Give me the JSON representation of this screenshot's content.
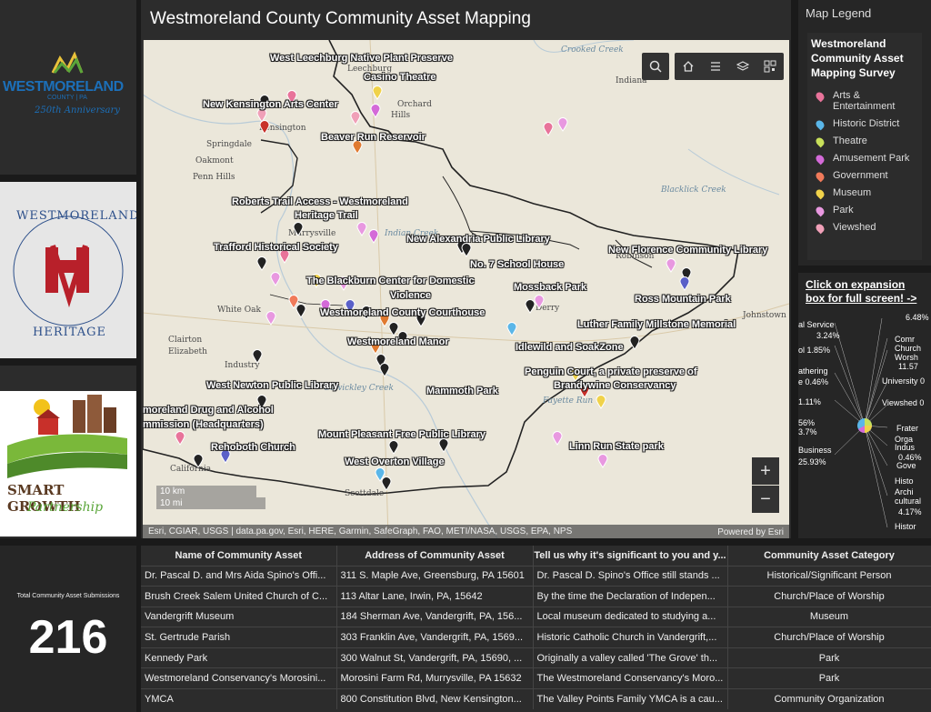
{
  "logos": {
    "westmoreland_line1": "WESTMORELAND",
    "westmoreland_line2": "COUNTY | PA",
    "westmoreland_line3": "250th Anniversary",
    "heritage_top": "WESTMORELAND",
    "heritage_bottom": "HERITAGE",
    "smart_growth_line1": "SMART GROWTH",
    "smart_growth_line2": "Partnership"
  },
  "map": {
    "title": "Westmoreland County Community Asset Mapping",
    "places": [
      "West Leechburg Native Plant Preserve",
      "Casino Theatre",
      "New Kensington Arts Center",
      "Beaver Run Reservoir",
      "Roberts Trail Access - Westmoreland",
      "Heritage Trail",
      "Trafford Historical Society",
      "New Alexandria Public Library",
      "New Florence Community Library",
      "No. 7 School House",
      "The Blackburn Center for Domestic",
      "Violence",
      "Mossback Park",
      "Ross Mountain Park",
      "Westmoreland County Courthouse",
      "Luther Family Millstone Memorial",
      "Westmoreland Manor",
      "Idlewild and SoakZone",
      "Penguin Court, a private preserve of",
      "Brandywine Conservancy",
      "West Newton Public Library",
      "Mammoth Park",
      "moreland Drug and Alcohol",
      "mmission (Headquarters)",
      "Mount Pleasant Free Public Library",
      "Rehoboth Church",
      "Linn Run State park",
      "West Overton Village"
    ],
    "towns": [
      "Leechburg",
      "Orchard",
      "Hills",
      "Indiana",
      "Kensington",
      "Springdale",
      "Oakmont",
      "Penn Hills",
      "Murrysville",
      "White Oak",
      "Clairton",
      "Elizabeth",
      "Industry",
      "California",
      "Scottdale",
      "Johnstown",
      "Robinson",
      "Derry",
      "Crooked Creek",
      "Blacklick Creek",
      "Sewickley Creek",
      "Fayette Run",
      "Indian Creek"
    ],
    "scale_km": "10 km",
    "scale_mi": "10 mi",
    "attribution": "Esri, CGIAR, USGS | data.pa.gov, Esri, HERE, Garmin, SafeGraph, FAO, METI/NASA, USGS, EPA, NPS",
    "powered_by": "Powered by Esri",
    "zoom_in": "+",
    "zoom_out": "−"
  },
  "legend": {
    "header": "Map Legend",
    "title": "Westmoreland Community Asset Mapping Survey",
    "items": [
      {
        "label": "Arts & Entertainment",
        "color": "#e8739a"
      },
      {
        "label": "Historic District",
        "color": "#5ab6e8"
      },
      {
        "label": "Theatre",
        "color": "#c8e05a"
      },
      {
        "label": "Amusement Park",
        "color": "#d46ad8"
      },
      {
        "label": "Government",
        "color": "#f07a5a"
      },
      {
        "label": "Museum",
        "color": "#f0d24a"
      },
      {
        "label": "Park",
        "color": "#e898e0"
      },
      {
        "label": "Viewshed",
        "color": "#f0a0b8"
      }
    ]
  },
  "expand": {
    "note": "Click on expansion box for full screen! ->",
    "labels": [
      "al Service",
      "3.24%",
      "6.48%",
      "ol 1.85%",
      "athering",
      "e 0.46%",
      "1.11%",
      "56%",
      "3.7%",
      "Business",
      "25.93%",
      "Comr",
      "Church",
      "Worsh",
      "11.57",
      "University 0",
      "Viewshed 0",
      "Frater",
      "Orga",
      "Indus",
      "0.46%",
      "Gove",
      "Histo",
      "Archi",
      "cultural",
      "4.17%",
      "Histor"
    ]
  },
  "summary": {
    "label": "Total Community Asset Submissions",
    "count": "216"
  },
  "table": {
    "headers": [
      "Name of Community Asset",
      "Address of Community Asset",
      "Tell us why it's significant to you and y...",
      "Community Asset Category"
    ],
    "rows": [
      [
        "Dr. Pascal D. and Mrs Aida Spino's Offi...",
        "311 S. Maple Ave, Greensburg, PA 15601",
        "Dr. Pascal D. Spino's Office still stands ...",
        "Historical/Significant Person"
      ],
      [
        "Brush Creek Salem United Church of C...",
        "113 Altar Lane, Irwin, PA, 15642",
        "By the time the Declaration of Indepen...",
        "Church/Place of Worship"
      ],
      [
        "Vandergrift Museum",
        "184 Sherman Ave, Vandergrift, PA, 156...",
        "Local museum dedicated to studying a...",
        "Museum"
      ],
      [
        "St. Gertrude Parish",
        "303 Franklin Ave, Vandergrift, PA, 1569...",
        "Historic Catholic Church in Vandergrift,...",
        "Church/Place of Worship"
      ],
      [
        "Kennedy Park",
        "300 Walnut St, Vandergrift, PA, 15690, ...",
        "Originally a valley called 'The Grove' th...",
        "Park"
      ],
      [
        "Westmoreland Conservancy's Morosini...",
        "Morosini Farm Rd, Murrysville, PA 15632",
        "The Westmoreland Conservancy's Moro...",
        "Park"
      ],
      [
        "YMCA",
        "800 Constitution Blvd, New Kensington...",
        "The Valley Points Family YMCA is a cau...",
        "Community Organization"
      ]
    ]
  }
}
